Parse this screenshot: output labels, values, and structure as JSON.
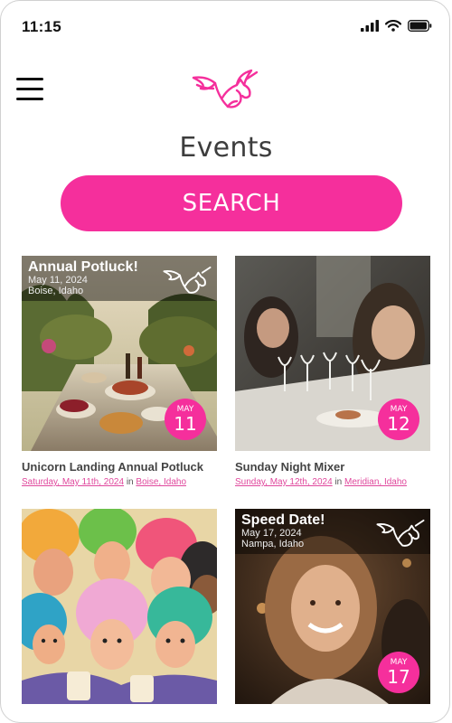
{
  "status_bar": {
    "time": "11:15"
  },
  "header": {
    "page_title": "Events",
    "search_label": "SEARCH"
  },
  "events": [
    {
      "overlay_title": "Annual Potluck!",
      "overlay_date": "May 11, 2024",
      "overlay_location": "Boise, Idaho",
      "badge_month": "MAY",
      "badge_day": "11",
      "title": "Unicorn Landing Annual Potluck",
      "date_link": "Saturday, May 11th, 2024",
      "connector": "in",
      "location_link": "Boise, Idaho"
    },
    {
      "badge_month": "MAY",
      "badge_day": "12",
      "title": "Sunday Night Mixer",
      "date_link": "Sunday, May 12th, 2024",
      "connector": "in",
      "location_link": "Meridian, Idaho"
    },
    {
      "title": ""
    },
    {
      "overlay_title": "Speed Date!",
      "overlay_date": "May 17, 2024",
      "overlay_location": "Nampa, Idaho",
      "badge_month": "MAY",
      "badge_day": "17"
    }
  ],
  "colors": {
    "accent": "#f52f9c",
    "link": "#e0489d"
  }
}
